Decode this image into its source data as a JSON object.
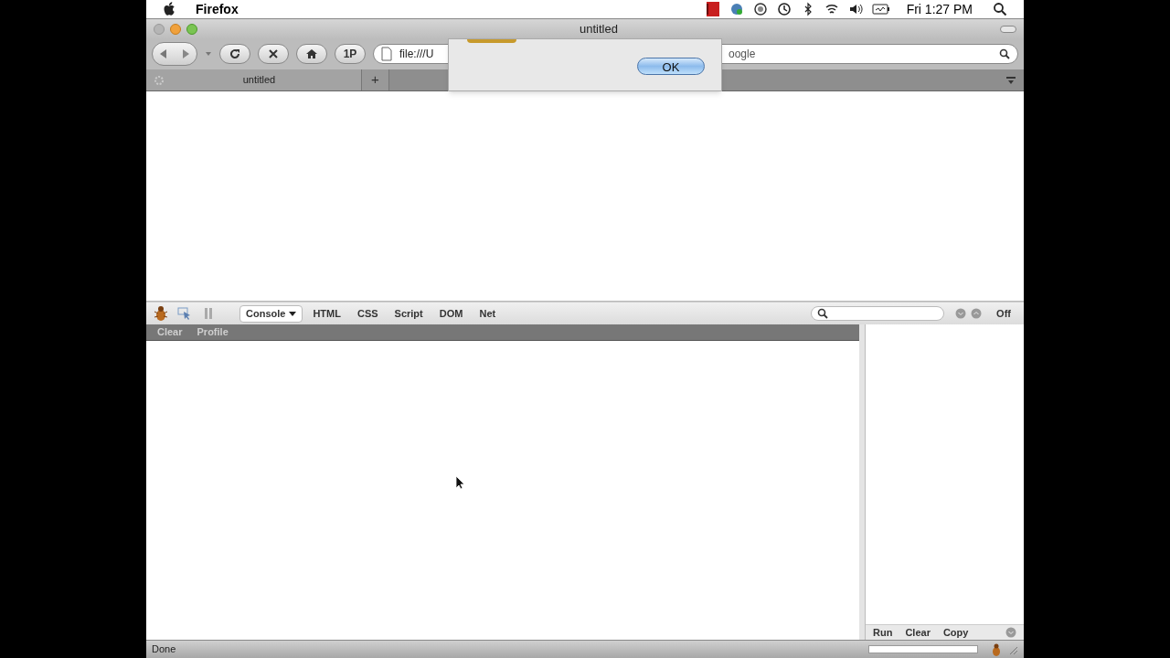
{
  "menu_bar": {
    "app_name": "Firefox",
    "clock": "Fri 1:27 PM"
  },
  "window": {
    "title": "untitled"
  },
  "toolbar": {
    "buttons": [
      "1P"
    ],
    "location": "file:///U",
    "search": "oogle"
  },
  "tabs": [
    {
      "label": "untitled",
      "selected": true
    }
  ],
  "new_tab": "+",
  "dialog": {
    "button": "OK"
  },
  "firebug": {
    "tabs": [
      {
        "label": "Console",
        "selected": true
      },
      {
        "label": "HTML",
        "selected": false
      },
      {
        "label": "CSS",
        "selected": false
      },
      {
        "label": "Script",
        "selected": false
      },
      {
        "label": "DOM",
        "selected": false
      },
      {
        "label": "Net",
        "selected": false
      }
    ],
    "off_label": "Off",
    "sub_buttons": [
      {
        "label": "Clear",
        "disabled": true
      },
      {
        "label": "Profile",
        "disabled": true
      }
    ],
    "side_buttons": [
      "Run",
      "Clear",
      "Copy"
    ]
  },
  "status_bar": {
    "text": "Done"
  }
}
